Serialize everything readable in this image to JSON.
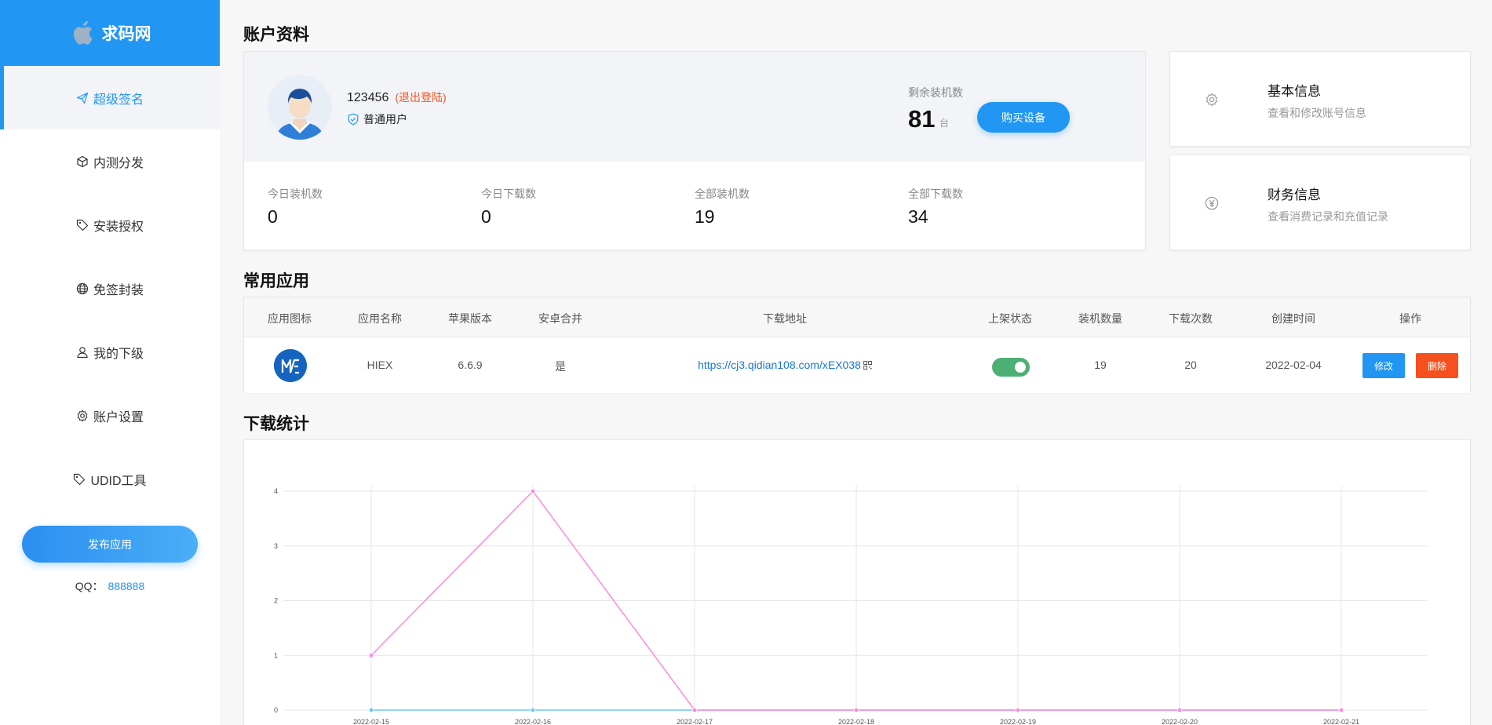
{
  "brand": {
    "name": "求码网"
  },
  "sidebar": {
    "items": [
      {
        "label": "超级签名",
        "icon": "send-icon",
        "active": true
      },
      {
        "label": "内测分发",
        "icon": "cube-icon",
        "active": false
      },
      {
        "label": "安装授权",
        "icon": "tag-icon",
        "active": false
      },
      {
        "label": "免签封装",
        "icon": "globe-icon",
        "active": false
      },
      {
        "label": "我的下级",
        "icon": "user-icon",
        "active": false
      },
      {
        "label": "账户设置",
        "icon": "gear-icon",
        "active": false
      },
      {
        "label": "UDID工具",
        "icon": "tag-icon",
        "active": false
      }
    ],
    "publish_label": "发布应用",
    "qq_label": "QQ：",
    "qq_number": "888888"
  },
  "account": {
    "title": "账户资料",
    "username": "123456",
    "logout_label": "(退出登陆)",
    "role": "普通用户",
    "remain_label": "剩余装机数",
    "remain_value": "81",
    "remain_unit": "台",
    "buy_label": "购买设备",
    "stats": [
      {
        "label": "今日装机数",
        "value": "0"
      },
      {
        "label": "今日下载数",
        "value": "0"
      },
      {
        "label": "全部装机数",
        "value": "19"
      },
      {
        "label": "全部下载数",
        "value": "34"
      }
    ]
  },
  "side_cards": [
    {
      "title": "基本信息",
      "desc": "查看和修改账号信息",
      "icon": "gear-icon"
    },
    {
      "title": "财务信息",
      "desc": "查看消费记录和充值记录",
      "icon": "yen-icon"
    }
  ],
  "apps": {
    "title": "常用应用",
    "columns": [
      "应用图标",
      "应用名称",
      "苹果版本",
      "安卓合并",
      "下载地址",
      "上架状态",
      "装机数量",
      "下载次数",
      "创建时间",
      "操作"
    ],
    "rows": [
      {
        "name": "HIEX",
        "ios_version": "6.6.9",
        "android_merge": "是",
        "url": "https://cj3.qidian108.com/xEX038",
        "listed": true,
        "installs": "19",
        "downloads": "20",
        "created": "2022-02-04",
        "edit_label": "修改",
        "delete_label": "删除"
      }
    ]
  },
  "download_stats": {
    "title": "下载统计"
  },
  "chart_data": {
    "type": "line",
    "x": [
      "2022-02-15",
      "2022-02-16",
      "2022-02-17",
      "2022-02-18",
      "2022-02-19",
      "2022-02-20",
      "2022-02-21"
    ],
    "series": [
      {
        "values": [
          1,
          4,
          0,
          0,
          0,
          0,
          0
        ],
        "color": "#ff88e0"
      },
      {
        "values": [
          0,
          0,
          0,
          0,
          0,
          0,
          0
        ],
        "color": "#6ec6f5"
      }
    ],
    "yticks": [
      "0",
      "1",
      "2",
      "3",
      "4"
    ],
    "ylim": [
      0,
      4
    ],
    "grid": true
  },
  "colors": {
    "accent": "#2196f3",
    "danger": "#f4511e",
    "success": "#4caf73",
    "link": "#1976d2"
  }
}
